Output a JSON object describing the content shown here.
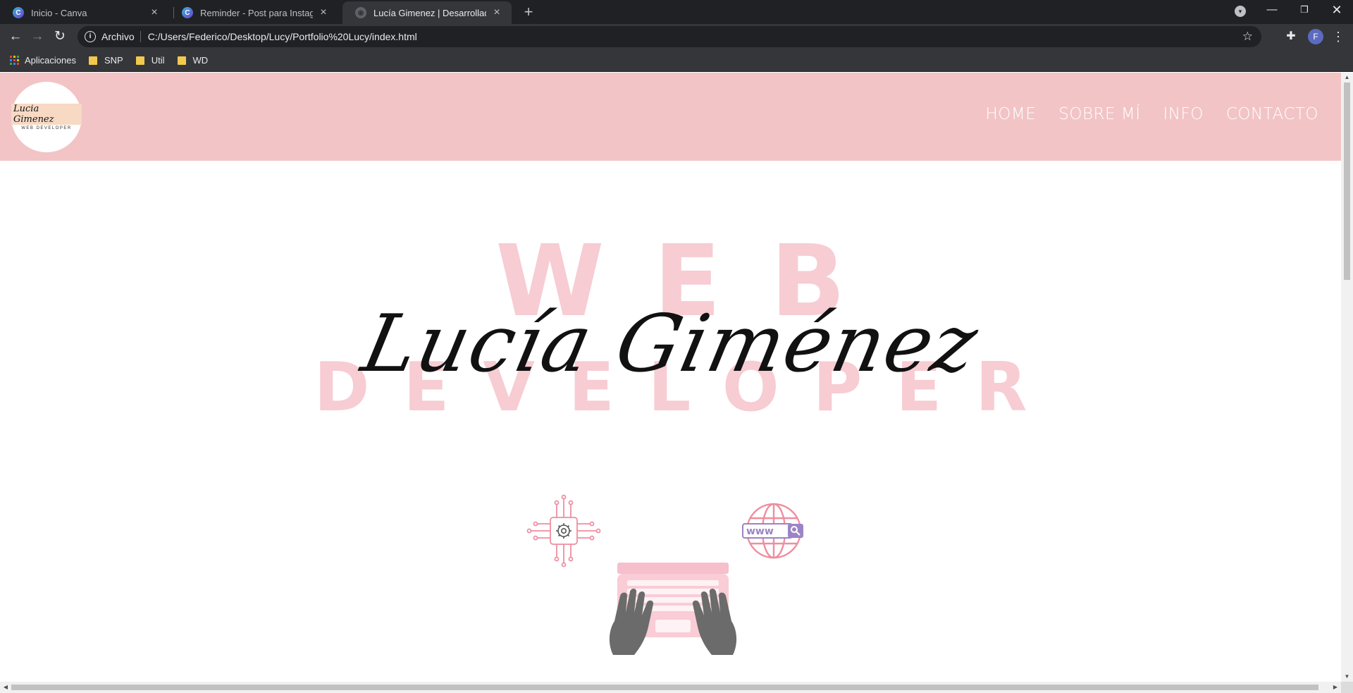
{
  "browser": {
    "tabs": [
      {
        "title": "Inicio - Canva",
        "favicon": "canva-icon",
        "active": false
      },
      {
        "title": "Reminder - Post para Instagram",
        "favicon": "canva-icon",
        "active": false
      },
      {
        "title": "Lucía Gimenez | Desarrolladora W",
        "favicon": "globe-icon",
        "active": true
      }
    ],
    "omnibox": {
      "scheme_label": "Archivo",
      "url": "C:/Users/Federico/Desktop/Lucy/Portfolio%20Lucy/index.html"
    },
    "profile_initial": "F",
    "bookmarks": [
      {
        "label": "Aplicaciones",
        "icon": "apps-grid-icon"
      },
      {
        "label": "SNP",
        "icon": "folder-icon"
      },
      {
        "label": "Util",
        "icon": "folder-icon"
      },
      {
        "label": "WD",
        "icon": "folder-icon"
      }
    ]
  },
  "site": {
    "logo": {
      "script": "Lucia Gimenez",
      "subtitle": "WEB DEVELOPER"
    },
    "nav": [
      "HOME",
      "SOBRE MÍ",
      "INFO",
      "CONTACTO"
    ],
    "hero": {
      "bg_line1": "WEB",
      "bg_line2": "DEVELOPER",
      "name": "Lucía Giménez",
      "illustration_text": "www"
    },
    "colors": {
      "header_bg": "#f2c4c6",
      "hero_bg_text": "#f7ccd3",
      "accent_pink": "#ee8ea0",
      "laptop_pink": "#f6bfcc",
      "hands_gray": "#6b6b6b",
      "search_purple": "#9b84c6"
    }
  }
}
